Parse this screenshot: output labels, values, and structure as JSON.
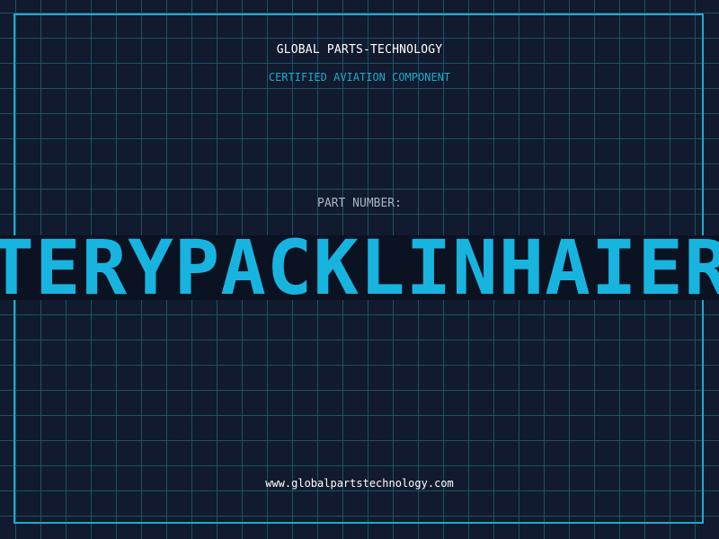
{
  "header": {
    "brand": "GLOBAL PARTS-TECHNOLOGY",
    "subtitle": "CERTIFIED AVIATION COMPONENT"
  },
  "part": {
    "label": "PART NUMBER:",
    "value": "BATTERYPACKLINHAIERGDT"
  },
  "footer": {
    "url": "www.globalpartstechnology.com"
  },
  "colors": {
    "background": "#111a2e",
    "grid": "#1c5266",
    "accent": "#1ea9cf",
    "text": "#ffffff"
  }
}
